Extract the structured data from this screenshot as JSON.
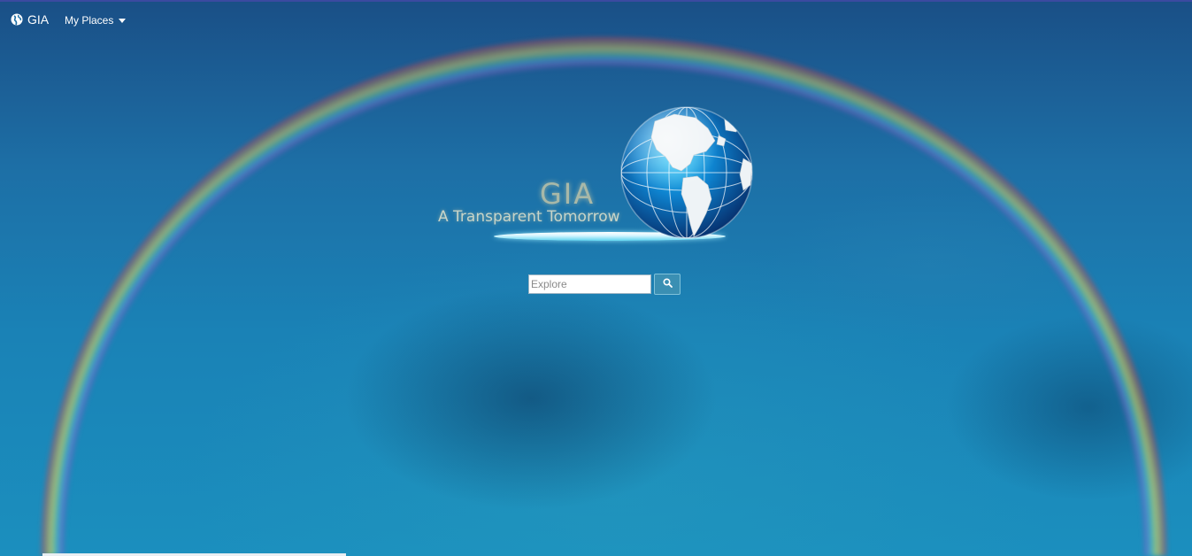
{
  "nav": {
    "brand_icon": "globe-icon",
    "brand_label": "GIA",
    "places_label": "My Places",
    "places_icon": "caret-down-icon"
  },
  "logo": {
    "title": "GIA",
    "tagline": "A Transparent Tomorrow"
  },
  "search": {
    "placeholder": "Explore",
    "value": "",
    "button_icon": "search-icon"
  },
  "colors": {
    "ocean": "#1b7fb4",
    "button": "#3a8fb3",
    "text": "#ffffff"
  }
}
